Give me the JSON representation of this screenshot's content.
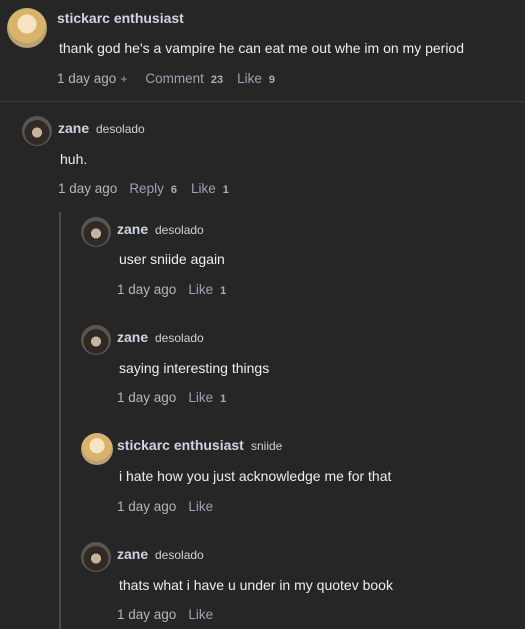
{
  "comments": [
    {
      "name": "stickarc enthusiast",
      "username": "",
      "text": "thank god he's a vampire he can eat me out whe im on my period",
      "time": "1 day ago",
      "plus": "+",
      "comment_label": "Comment",
      "comment_count": "23",
      "like_label": "Like",
      "like_count": "9"
    },
    {
      "name": "zane",
      "username": "desolado",
      "text": "huh.",
      "time": "1 day ago",
      "reply_label": "Reply",
      "reply_count": "6",
      "like_label": "Like",
      "like_count": "1"
    },
    {
      "name": "zane",
      "username": "desolado",
      "text": "user sniide again",
      "time": "1 day ago",
      "like_label": "Like",
      "like_count": "1"
    },
    {
      "name": "zane",
      "username": "desolado",
      "text": "saying interesting things",
      "time": "1 day ago",
      "like_label": "Like",
      "like_count": "1"
    },
    {
      "name": "stickarc enthusiast",
      "username": "sniide",
      "text": "i hate how you just acknowledge me for that",
      "time": "1 day ago",
      "like_label": "Like",
      "like_count": ""
    },
    {
      "name": "zane",
      "username": "desolado",
      "text": "thats what i have u under in my quotev book",
      "time": "1 day ago",
      "like_label": "Like",
      "like_count": ""
    }
  ]
}
